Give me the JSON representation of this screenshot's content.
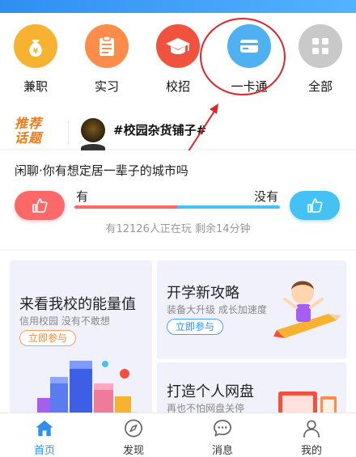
{
  "icons": [
    {
      "label": "兼职",
      "icon": "money-bag-icon",
      "color": "#f7b231"
    },
    {
      "label": "实习",
      "icon": "clipboard-icon",
      "color": "#ff8c4a"
    },
    {
      "label": "校招",
      "icon": "graduation-cap-icon",
      "color": "#f0523e"
    },
    {
      "label": "一卡通",
      "icon": "card-icon",
      "color": "#4fb0f2"
    },
    {
      "label": "全部",
      "icon": "grid-icon",
      "color": "#c9c9c9"
    }
  ],
  "topic": {
    "badge_line1": "推荐",
    "badge_line2": "话题",
    "text": "#校园杂货铺子#"
  },
  "poll": {
    "question": "闲聊·你有想定居一辈子的城市吗",
    "yes_label": "有",
    "no_label": "没有",
    "yes_fraction": 0.5,
    "stats": "有12126人正在玩 剩余14分钟",
    "yes_color": "#ff6868",
    "no_color": "#45c2f4"
  },
  "cards": {
    "big": {
      "title": "来看我校的能量值",
      "sub": "信用校园 没有不敢想",
      "btn": "立即参与"
    },
    "s1": {
      "title": "开学新攻略",
      "sub": "装备大升级 成长加速度",
      "btn": "立即参与"
    },
    "s2": {
      "title": "打造个人网盘",
      "sub": "再也不怕网盘关停"
    }
  },
  "tabs": [
    {
      "label": "首页",
      "icon": "home-icon",
      "active": true
    },
    {
      "label": "发现",
      "icon": "compass-icon",
      "active": false
    },
    {
      "label": "消息",
      "icon": "chat-icon",
      "active": false
    },
    {
      "label": "我的",
      "icon": "person-icon",
      "active": false
    }
  ],
  "colors": {
    "accent": "#2f8ff0",
    "annotation": "#e0242c"
  }
}
